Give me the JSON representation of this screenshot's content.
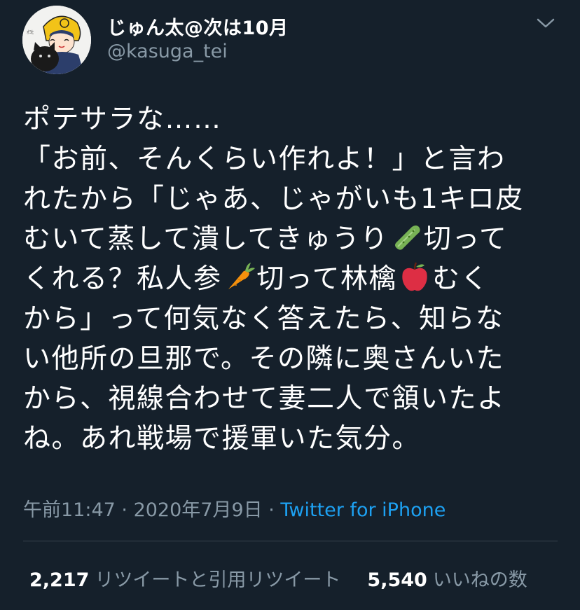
{
  "user": {
    "display_name": "じゅん太@次は10月",
    "handle": "@kasuga_tei"
  },
  "tweet": {
    "lines": [
      {
        "text": "ポテサラな……"
      },
      {
        "text": "「お前、そんくらい作れよ！」と言わ"
      },
      {
        "text": "れたから「じゃあ、じゃがいも1キロ皮"
      },
      {
        "text": "むいて蒸して潰してきゅうり",
        "emoji": "cucumber-emoji",
        "after": "切って"
      },
      {
        "text": "くれる？私人参",
        "emoji": "carrot-emoji",
        "after": "切って林檎",
        "emoji2": "apple-emoji",
        "after2": "むく"
      },
      {
        "text": "から」って何気なく答えたら、知らな"
      },
      {
        "text": "い他所の旦那で。その隣に奥さんいた"
      },
      {
        "text": "から、視線合わせて妻二人で頷いたよ"
      },
      {
        "text": "ね。あれ戦場で援軍いた気分。"
      }
    ]
  },
  "meta": {
    "time": "午前11:47",
    "separator": " · ",
    "date": "2020年7月9日",
    "separator2": " · ",
    "source": "Twitter for iPhone"
  },
  "stats": {
    "retweets_count": "2,217",
    "retweets_label": "リツイートと引用リツイート",
    "likes_count": "5,540",
    "likes_label": "いいねの数"
  },
  "colors": {
    "background": "#15202b",
    "secondary_text": "#8899a6",
    "link": "#1da1f2",
    "divider": "#38444d"
  }
}
